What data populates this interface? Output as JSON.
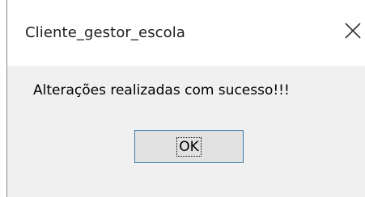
{
  "window": {
    "title": "Cliente_gestor_escola",
    "close_icon": "close-icon"
  },
  "dialog": {
    "message": "Alterações realizadas com sucesso!!!",
    "ok_label": "OK"
  },
  "colors": {
    "titlebar_bg": "#ffffff",
    "content_bg": "#f0f0f0",
    "button_bg": "#e1e1e1",
    "button_border": "#3c7fb1"
  }
}
